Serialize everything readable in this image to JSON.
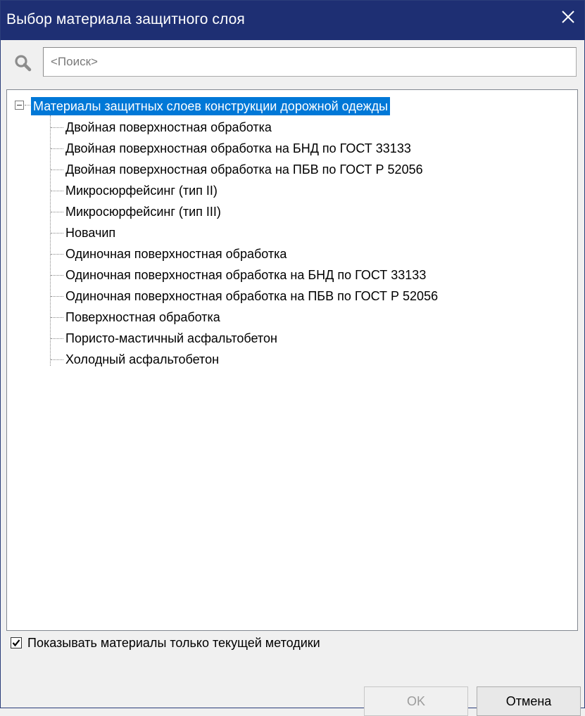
{
  "window": {
    "title": "Выбор материала защитного слоя",
    "close_icon": "close-icon"
  },
  "search": {
    "placeholder": "<Поиск>",
    "value": "",
    "icon": "search-icon"
  },
  "tree": {
    "root_label": "Материалы защитных слоев конструкции дорожной одежды",
    "root_expanded": true,
    "root_selected": true,
    "items": [
      {
        "label": "Двойная поверхностная обработка"
      },
      {
        "label": "Двойная поверхностная обработка на БНД по ГОСТ 33133"
      },
      {
        "label": "Двойная поверхностная обработка на ПБВ по ГОСТ Р 52056"
      },
      {
        "label": "Микросюрфейсинг (тип II)"
      },
      {
        "label": "Микросюрфейсинг (тип III)"
      },
      {
        "label": "Новачип"
      },
      {
        "label": "Одиночная поверхностная обработка"
      },
      {
        "label": "Одиночная поверхностная обработка на БНД по ГОСТ 33133"
      },
      {
        "label": "Одиночная поверхностная обработка на ПБВ по ГОСТ Р 52056"
      },
      {
        "label": "Поверхностная обработка"
      },
      {
        "label": "Пористо-мастичный асфальтобетон"
      },
      {
        "label": "Холодный асфальтобетон"
      }
    ]
  },
  "filter": {
    "checkbox_label": "Показывать материалы только текущей методики",
    "checked": true
  },
  "buttons": {
    "ok_label": "OK",
    "ok_enabled": false,
    "cancel_label": "Отмена"
  },
  "colors": {
    "titlebar": "#1e2f73",
    "selection": "#0078d7",
    "background": "#f0f0f0"
  }
}
